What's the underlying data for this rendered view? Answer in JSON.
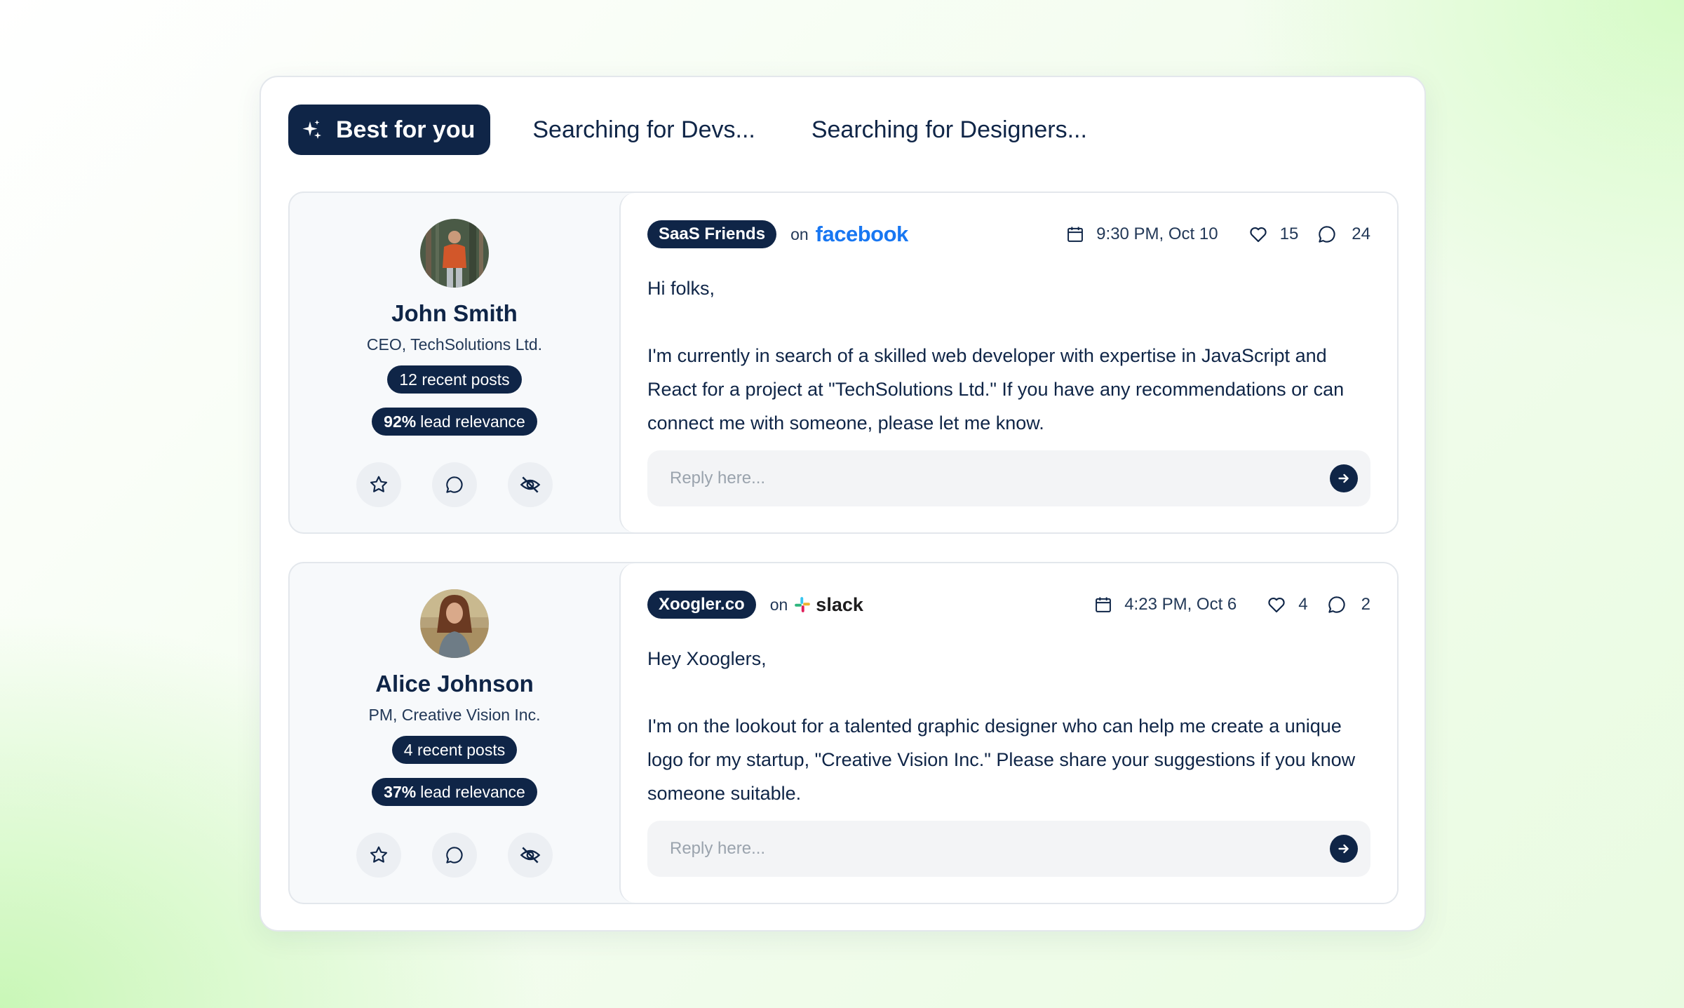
{
  "tabs": [
    {
      "label": "Best for you",
      "active": true,
      "icon": "sparkle-icon"
    },
    {
      "label": "Searching for Devs...",
      "active": false
    },
    {
      "label": "Searching for Designers...",
      "active": false
    }
  ],
  "colors": {
    "navy": "#0f2547",
    "facebook": "#1877f2",
    "background_green": "#d6fbc7"
  },
  "leads": [
    {
      "name": "John Smith",
      "role": "CEO, TechSolutions Ltd.",
      "recent_posts": "12 recent posts",
      "relevance_value": "92%",
      "relevance_label": "lead relevance",
      "post": {
        "group": "SaaS Friends",
        "on": "on",
        "platform": "facebook",
        "time": "9:30 PM, Oct 10",
        "likes": "15",
        "comments": "24",
        "greeting": "Hi folks,",
        "message": "I'm currently in search of a skilled web developer with expertise in JavaScript and React for a project at \"TechSolutions Ltd.\" If you have any recommendations or can connect me with someone, please let me know.",
        "reply_placeholder": "Reply here..."
      }
    },
    {
      "name": "Alice Johnson",
      "role": "PM, Creative Vision Inc.",
      "recent_posts": "4 recent posts",
      "relevance_value": "37%",
      "relevance_label": "lead relevance",
      "post": {
        "group": "Xoogler.co",
        "on": "on",
        "platform": "slack",
        "time": "4:23 PM, Oct 6",
        "likes": "4",
        "comments": "2",
        "greeting": "Hey Xooglers,",
        "message": "I'm on the lookout for a talented graphic designer who can help me create a unique logo for my startup, \"Creative Vision Inc.\" Please share your suggestions if you know someone suitable.",
        "reply_placeholder": "Reply here..."
      }
    }
  ]
}
